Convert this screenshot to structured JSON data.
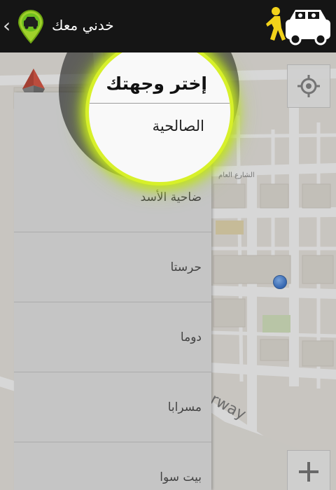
{
  "header": {
    "title": "خدني معك",
    "back_icon": "chevron-left-icon",
    "app_icon": "map-pin-car-icon",
    "mode_icon": "pedestrian-and-car-icon",
    "accent": "#c8e629"
  },
  "map": {
    "street_label": "الشارع العام",
    "way_label": "rway",
    "water_color": "#aad3df",
    "my_location_color": "#2a6fd6"
  },
  "spotlight": {
    "title": "إختر وجهتك",
    "highlighted_item": "الصالحية",
    "ring_color": "#d7f02a"
  },
  "destinations": [
    "ضاحية الأسد",
    "حرستا",
    "دوما",
    "مسرابا",
    "بيت سوا"
  ],
  "controls": {
    "compass_icon": "compass-icon",
    "locate_icon": "crosshair-icon",
    "zoom_in_icon": "plus-icon"
  }
}
